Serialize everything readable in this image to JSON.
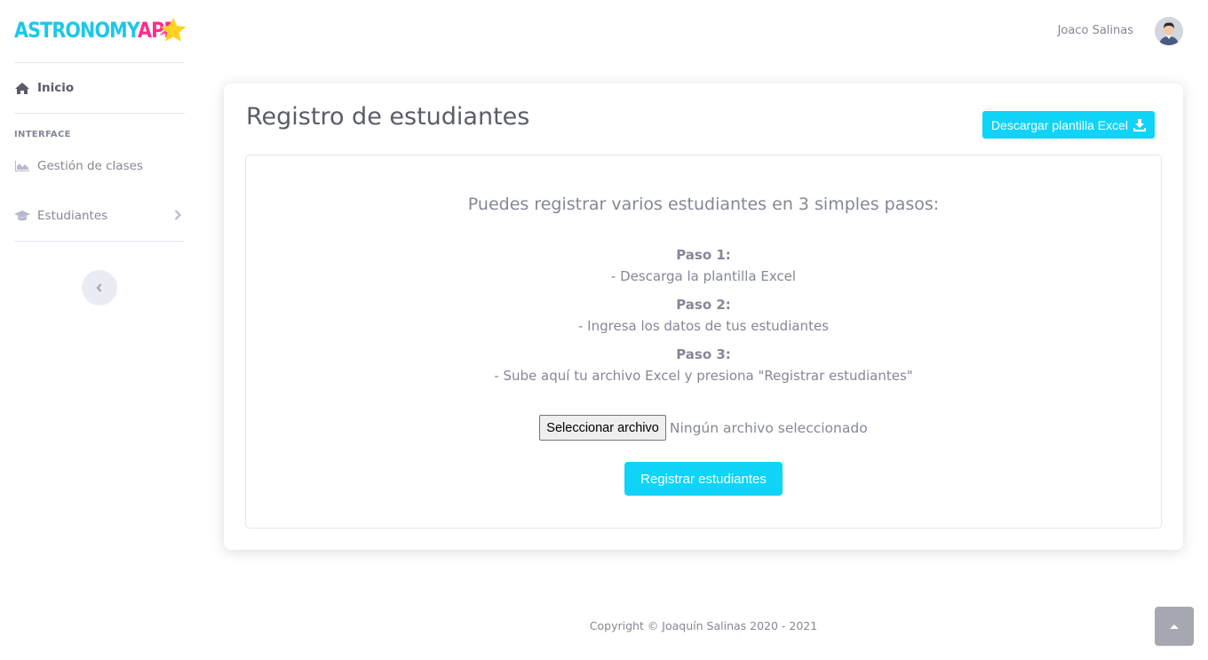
{
  "brand": {
    "part1": "ASTRONOMY",
    "part2": "APP"
  },
  "sidebar": {
    "home_label": "Inicio",
    "section_heading": "INTERFACE",
    "items": [
      {
        "label": "Gestión de clases",
        "icon": "area-chart-icon"
      },
      {
        "label": "Estudiantes",
        "icon": "graduation-cap-icon"
      }
    ]
  },
  "topbar": {
    "user_name": "Joaco Salinas"
  },
  "main": {
    "title": "Registro de estudiantes",
    "download_button": "Descargar plantilla Excel",
    "lead": "Puedes registrar varios estudiantes en 3 simples pasos:",
    "steps": [
      {
        "title": "Paso 1:",
        "text": "- Descarga la plantilla Excel"
      },
      {
        "title": "Paso 2:",
        "text": "- Ingresa los datos de tus estudiantes"
      },
      {
        "title": "Paso 3:",
        "text": "- Sube aquí tu archivo Excel y presiona \"Registrar estudiantes\""
      }
    ],
    "file_button": "Seleccionar archivo",
    "file_status": "Ningún archivo seleccionado",
    "register_button": "Registrar estudiantes"
  },
  "footer": {
    "copyright": "Copyright © Joaquín Salinas 2020 - 2021"
  },
  "colors": {
    "accent": "#0fd4f8",
    "brand_cyan": "#1cc8e8",
    "brand_pink": "#ff2d8a",
    "star": "#ffd21f"
  }
}
